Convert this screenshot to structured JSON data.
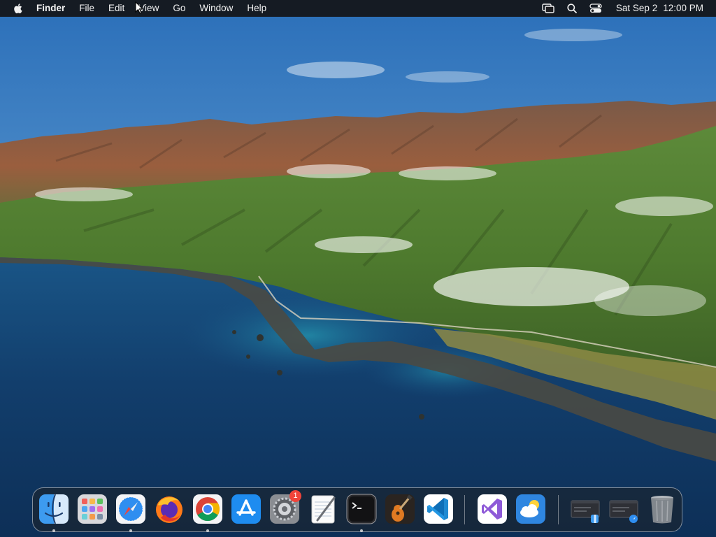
{
  "menubar": {
    "app_name": "Finder",
    "menus": [
      "File",
      "Edit",
      "View",
      "Go",
      "Window",
      "Help"
    ],
    "status_icons": [
      "screen-mirroring-icon",
      "spotlight-search-icon",
      "control-center-icon"
    ],
    "date": "Sat Sep 2",
    "time": "12:00 PM"
  },
  "dock": {
    "apps": [
      {
        "id": "finder",
        "icon": "finder-icon",
        "running": true
      },
      {
        "id": "launchpad",
        "icon": "launchpad-icon",
        "running": false
      },
      {
        "id": "safari",
        "icon": "safari-icon",
        "running": true
      },
      {
        "id": "firefox",
        "icon": "firefox-icon",
        "running": false
      },
      {
        "id": "chrome",
        "icon": "chrome-icon",
        "running": true
      },
      {
        "id": "app-store",
        "icon": "app-store-icon",
        "running": false
      },
      {
        "id": "system-preferences",
        "icon": "system-preferences-icon",
        "running": false,
        "badge": "1"
      },
      {
        "id": "textedit",
        "icon": "textedit-icon",
        "running": false
      },
      {
        "id": "terminal",
        "icon": "terminal-icon",
        "running": true
      },
      {
        "id": "garageband",
        "icon": "garageband-icon",
        "running": false
      },
      {
        "id": "vscode",
        "icon": "vscode-icon",
        "running": false
      },
      {
        "id": "visual-studio",
        "icon": "visual-studio-icon",
        "running": false
      },
      {
        "id": "weather",
        "icon": "weather-icon",
        "running": false
      },
      {
        "id": "recent-folder-1",
        "icon": "recent-window-icon",
        "running": false
      },
      {
        "id": "recent-folder-2",
        "icon": "recent-window-icon",
        "running": false
      },
      {
        "id": "trash",
        "icon": "trash-icon",
        "running": false
      }
    ]
  },
  "colors": {
    "menubar_bg": "#141416",
    "badge": "#f0443a",
    "sky_top": "#2f78c4",
    "ocean": "#123f6e"
  }
}
